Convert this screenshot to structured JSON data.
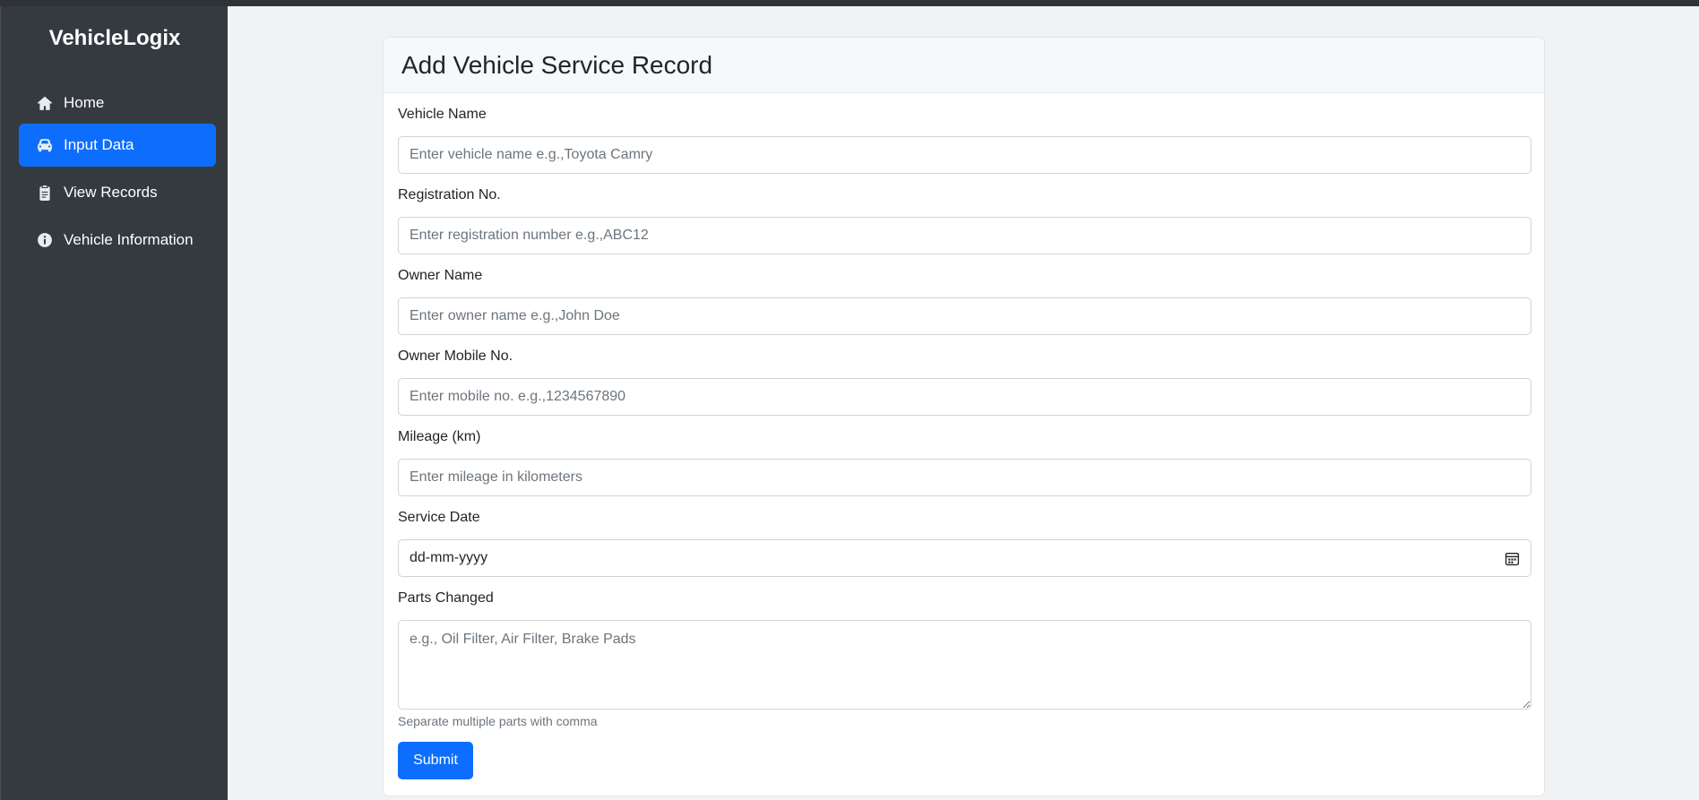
{
  "app": {
    "brand": "VehicleLogix"
  },
  "sidebar": {
    "items": [
      {
        "label": "Home",
        "icon": "home-icon",
        "active": false
      },
      {
        "label": "Input Data",
        "icon": "car-icon",
        "active": true
      },
      {
        "label": "View Records",
        "icon": "clipboard-icon",
        "active": false
      },
      {
        "label": "Vehicle Information",
        "icon": "info-icon",
        "active": false
      }
    ]
  },
  "form": {
    "title": "Add Vehicle Service Record",
    "fields": {
      "vehicle_name": {
        "label": "Vehicle Name",
        "placeholder": "Enter vehicle name e.g.,Toyota Camry"
      },
      "registration": {
        "label": "Registration No.",
        "placeholder": "Enter registration number e.g.,ABC12"
      },
      "owner_name": {
        "label": "Owner Name",
        "placeholder": "Enter owner name e.g.,John Doe"
      },
      "owner_mobile": {
        "label": "Owner Mobile No.",
        "placeholder": "Enter mobile no. e.g.,1234567890"
      },
      "mileage": {
        "label": "Mileage (km)",
        "placeholder": "Enter mileage in kilometers"
      },
      "service_date": {
        "label": "Service Date",
        "value": "dd-mm-yyyy"
      },
      "parts": {
        "label": "Parts Changed",
        "placeholder": "e.g., Oil Filter, Air Filter, Brake Pads",
        "help": "Separate multiple parts with comma"
      }
    },
    "submit_label": "Submit"
  },
  "colors": {
    "sidebar_bg": "#343a40",
    "accent": "#0d6efd",
    "page_bg": "#f1f2f4"
  }
}
